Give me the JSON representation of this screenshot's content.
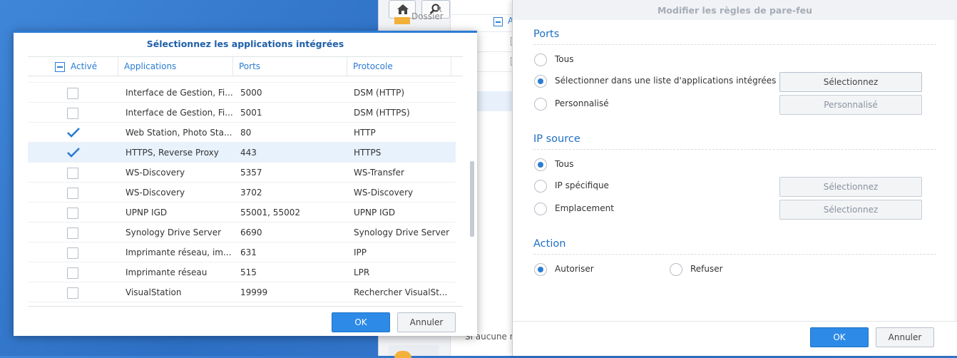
{
  "background_window": {
    "search_fragment": "R",
    "folder_label": "Dossier",
    "column_label_fragment": "A",
    "status_fragment": "Si aucune rè"
  },
  "apps_dialog": {
    "title": "Sélectionnez les applications intégrées",
    "columns": {
      "active": "Activé",
      "applications": "Applications",
      "ports": "Ports",
      "protocol": "Protocole"
    },
    "rows": [
      {
        "app": "Interface de Gestion, Fi...",
        "ports": "5000",
        "protocol": "DSM (HTTP)",
        "checked": false
      },
      {
        "app": "Interface de Gestion, Fi...",
        "ports": "5001",
        "protocol": "DSM (HTTPS)",
        "checked": false
      },
      {
        "app": "Web Station, Photo Sta...",
        "ports": "80",
        "protocol": "HTTP",
        "checked": true
      },
      {
        "app": "HTTPS, Reverse Proxy",
        "ports": "443",
        "protocol": "HTTPS",
        "checked": true,
        "selected": true
      },
      {
        "app": "WS-Discovery",
        "ports": "5357",
        "protocol": "WS-Transfer",
        "checked": false
      },
      {
        "app": "WS-Discovery",
        "ports": "3702",
        "protocol": "WS-Discovery",
        "checked": false
      },
      {
        "app": "UPNP IGD",
        "ports": "55001, 55002",
        "protocol": "UPNP IGD",
        "checked": false
      },
      {
        "app": "Synology Drive Server",
        "ports": "6690",
        "protocol": "Synology Drive Server",
        "checked": false
      },
      {
        "app": "Imprimante réseau, im...",
        "ports": "631",
        "protocol": "IPP",
        "checked": false
      },
      {
        "app": "Imprimante réseau",
        "ports": "515",
        "protocol": "LPR",
        "checked": false
      },
      {
        "app": "VisualStation",
        "ports": "19999",
        "protocol": "Rechercher VisualSt...",
        "checked": false
      }
    ],
    "ok_label": "OK",
    "cancel_label": "Annuler"
  },
  "fw_dialog": {
    "title": "Modifier les règles de pare-feu",
    "ports": {
      "heading": "Ports",
      "options": [
        "Tous",
        "Sélectionner dans une liste d'applications intégrées",
        "Personnalisé"
      ],
      "selected_index": 1,
      "select_button": "Sélectionnez",
      "custom_button": "Personnalisé"
    },
    "ip_source": {
      "heading": "IP source",
      "options": [
        "Tous",
        "IP spécifique",
        "Emplacement"
      ],
      "selected_index": 0,
      "ip_button": "Sélectionnez",
      "location_button": "Sélectionnez"
    },
    "action": {
      "heading": "Action",
      "allow": "Autoriser",
      "deny": "Refuser",
      "selected": "allow"
    },
    "ok_label": "OK",
    "cancel_label": "Annuler"
  },
  "colors": {
    "accent": "#2b7cd3",
    "primary_button": "#2d8ae6",
    "desktop": "#3a7fd4"
  }
}
